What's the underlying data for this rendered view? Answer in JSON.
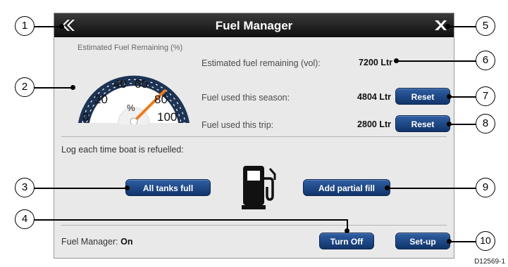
{
  "window": {
    "title": "Fuel Manager",
    "back_icon": "double-chevron-left-icon",
    "close_icon": "x-close-icon"
  },
  "gauge": {
    "title": "Estimated Fuel Remaining (%)",
    "unit": "%",
    "level_percent": 75,
    "ticks": [
      "0",
      "20",
      "40",
      "60",
      "80",
      "100"
    ]
  },
  "stats": {
    "remaining_label": "Estimated fuel remaining (vol):",
    "remaining_value": "7200 Ltr",
    "season_label": "Fuel used this season:",
    "season_value": "4804 Ltr",
    "trip_label": "Fuel used this trip:",
    "trip_value": "2800 Ltr",
    "reset_label": "Reset"
  },
  "refuel": {
    "log_label": "Log each time boat is refuelled:",
    "all_tanks_label": "All tanks full",
    "partial_fill_label": "Add partial fill",
    "pump_icon": "fuel-pump-icon"
  },
  "footer": {
    "status_label": "Fuel Manager:",
    "status_value": "On",
    "turn_off_label": "Turn Off",
    "setup_label": "Set-up"
  },
  "callouts": [
    "1",
    "2",
    "3",
    "4",
    "5",
    "6",
    "7",
    "8",
    "9",
    "10"
  ],
  "figure_ref": "D12569-1",
  "colors": {
    "button_blue": "#1d4584",
    "needle_orange": "#f07a1a",
    "title_bar": "#1a1a1a",
    "panel": "#e9e9e9"
  }
}
